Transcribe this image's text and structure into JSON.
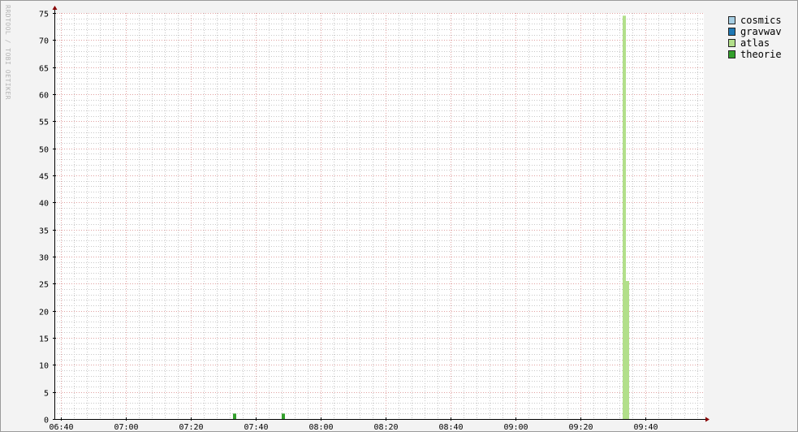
{
  "watermark": "RRDTOOL / TOBI OETIKER",
  "colors": {
    "grid_major": "#e0a0a0",
    "grid_minor": "#c8c8c8",
    "axis": "#000000",
    "arrow": "#880000"
  },
  "legend": [
    {
      "name": "cosmics",
      "color": "#a6cee3"
    },
    {
      "name": "gravwav",
      "color": "#1f78b4"
    },
    {
      "name": "atlas",
      "color": "#b2df8a"
    },
    {
      "name": "theorie",
      "color": "#33a02c"
    }
  ],
  "chart_data": {
    "type": "bar",
    "stacked": true,
    "title": "",
    "xlabel": "",
    "ylabel": "",
    "xlim": [
      "06:38",
      "09:58"
    ],
    "ylim": [
      0,
      75
    ],
    "x_ticks": [
      "06:40",
      "07:00",
      "07:20",
      "07:40",
      "08:00",
      "08:20",
      "08:40",
      "09:00",
      "09:20",
      "09:40"
    ],
    "y_ticks": [
      0,
      5,
      10,
      15,
      20,
      25,
      30,
      35,
      40,
      45,
      50,
      55,
      60,
      65,
      70,
      75
    ],
    "grid": true,
    "legend_position": "right",
    "series": [
      {
        "name": "cosmics",
        "color": "#a6cee3",
        "points": []
      },
      {
        "name": "gravwav",
        "color": "#1f78b4",
        "points": []
      },
      {
        "name": "atlas",
        "color": "#b2df8a",
        "points": [
          {
            "start": "09:33",
            "end": "09:34",
            "value": 74.5
          },
          {
            "start": "09:34",
            "end": "09:35",
            "value": 25.5
          }
        ]
      },
      {
        "name": "theorie",
        "color": "#33a02c",
        "points": [
          {
            "start": "07:33",
            "end": "07:34",
            "value": 1
          },
          {
            "start": "07:48",
            "end": "07:49",
            "value": 1
          }
        ]
      }
    ]
  }
}
